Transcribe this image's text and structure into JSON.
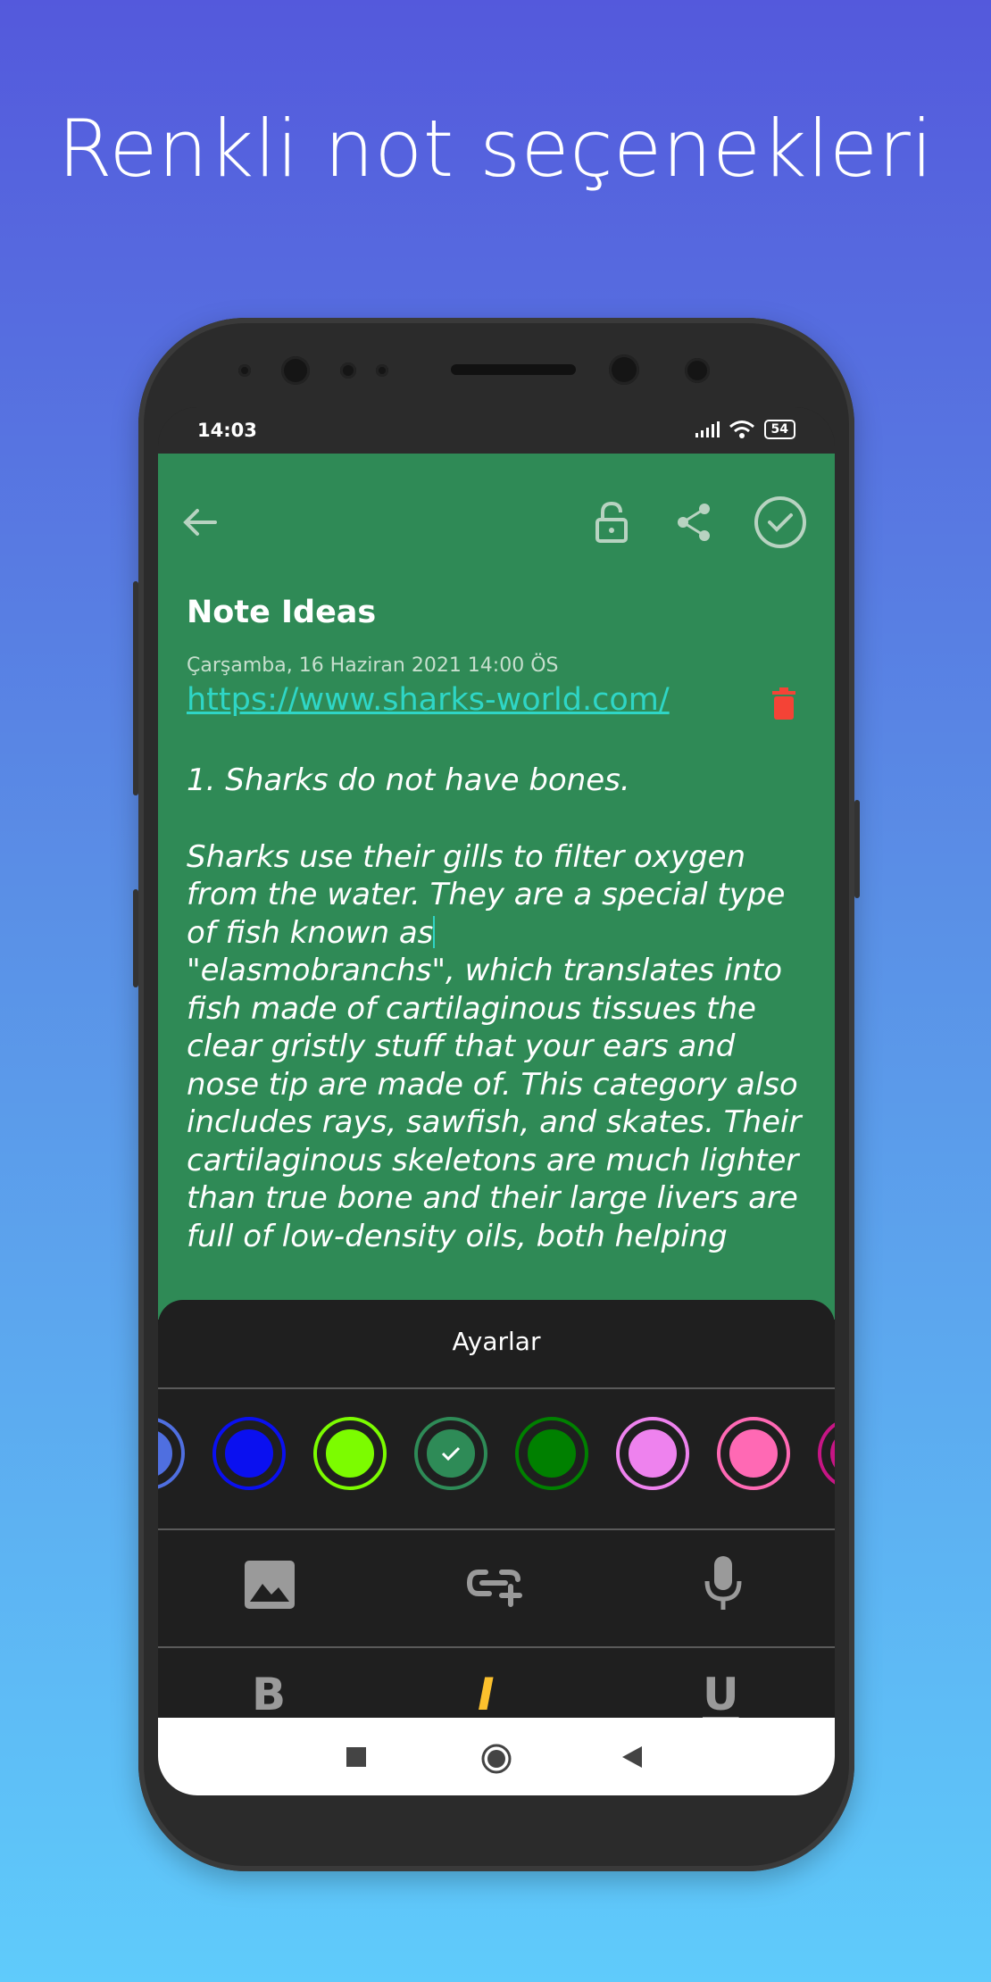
{
  "headline": "Renkli not seçenekleri",
  "status_bar": {
    "time": "14:03",
    "battery": "54"
  },
  "toolbar": {
    "back_icon": "arrow-left-icon",
    "lock_icon": "lock-open-icon",
    "share_icon": "share-icon",
    "done_icon": "check-circle-icon"
  },
  "note": {
    "title": "Note Ideas",
    "date": "Çarşamba, 16 Haziran 2021 14:00 ÖS",
    "link": "https://www.sharks-world.com/",
    "paragraph1": "1. Sharks do not have bones.",
    "paragraph2_before_caret": "Sharks use their gills to filter oxygen\nfrom the water. They are a special type\nof fish known as",
    "paragraph2_after_caret": "\n\"elasmobranchs\", which translates into\nfish made of cartilaginous tissues the\nclear gristly stuff that your ears and\nnose tip are made of. This category also\nincludes rays, sawfish, and skates. Their\ncartilaginous skeletons are much lighter\nthan true bone and their large livers are\nfull of low-density oils, both helping"
  },
  "settings_sheet": {
    "title": "Ayarlar",
    "colors": [
      {
        "name": "cornflower",
        "hex": "#4f6fe0",
        "selected": false
      },
      {
        "name": "blue",
        "hex": "#0a10f0",
        "selected": false
      },
      {
        "name": "lime",
        "hex": "#7cfc00",
        "selected": false
      },
      {
        "name": "sea-green",
        "hex": "#2e8b57",
        "selected": true
      },
      {
        "name": "green",
        "hex": "#008000",
        "selected": false
      },
      {
        "name": "violet",
        "hex": "#ee82ee",
        "selected": false
      },
      {
        "name": "hot-pink",
        "hex": "#ff69b4",
        "selected": false
      },
      {
        "name": "magenta",
        "hex": "#c71585",
        "selected": false
      }
    ],
    "tools": [
      "image-icon",
      "add-link-icon",
      "microphone-icon"
    ],
    "format": {
      "bold": "B",
      "italic": "I",
      "underline": "U",
      "active": "italic",
      "active_color": "#fbc02d"
    }
  },
  "colors": {
    "note_background": "#2f8a56",
    "link": "#2fd6c6",
    "delete": "#f44336"
  }
}
